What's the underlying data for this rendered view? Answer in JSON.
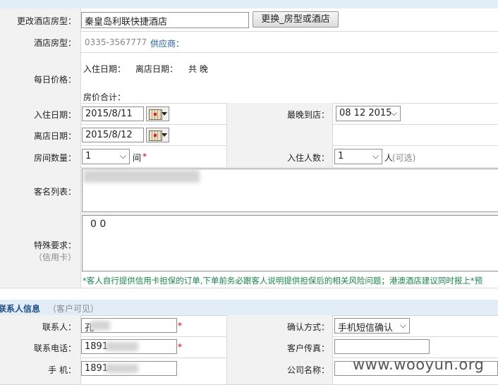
{
  "hotel_change": {
    "label": "更改酒店房型：",
    "value": "秦皇岛利联快捷酒店",
    "button": "更换_房型或酒店"
  },
  "hotel_room": {
    "label": "酒店房型：",
    "phone": "0335-3567777",
    "supplier_label": "供应商："
  },
  "daily_price": {
    "label": "每日价格：",
    "checkin_label": "入住日期：",
    "checkout_label": "离店日期：",
    "total_nights": "共 晚",
    "total_price_label": "房价合计："
  },
  "checkin": {
    "label": "入住日期：",
    "value": "2015/8/11"
  },
  "latest_arrival": {
    "label": "最晚到店：",
    "value": "08 12 2015"
  },
  "checkout": {
    "label": "离店日期：",
    "value": "2015/8/12"
  },
  "rooms": {
    "label": "房间数量：",
    "value": "1",
    "unit": "间",
    "required": "*"
  },
  "guests": {
    "label": "入住人数：",
    "value": "1",
    "unit": "人",
    "optional": "(可选)"
  },
  "guest_list": {
    "label": "客名列表："
  },
  "special": {
    "label": "特殊要求：",
    "sub_label": "（信用卡）",
    "value": "0 0"
  },
  "notice": "*客人自行提供信用卡担保的订单,下单前务必跟客人说明提供担保后的相关风险问题；港澳酒店建议同时报上*预",
  "contact_section": {
    "title": "联系人信息",
    "note": "（客户可见）"
  },
  "contact": {
    "label": "联系人：",
    "value": "孔",
    "required": "*"
  },
  "confirm_method": {
    "label": "确认方式：",
    "value": "手机短信确认"
  },
  "contact_phone": {
    "label": "联系电话：",
    "value": "1891",
    "required": "*"
  },
  "customer_fax": {
    "label": "客户传真："
  },
  "mobile": {
    "label": "手 机：",
    "value": "1891"
  },
  "company_name": {
    "label": "公司名称："
  },
  "watermark": "www.wooyun.org"
}
